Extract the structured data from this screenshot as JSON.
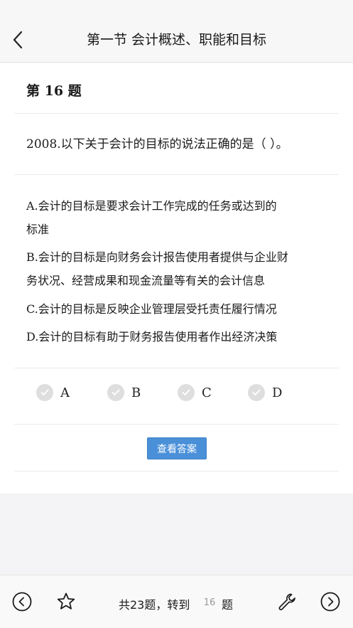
{
  "header": {
    "title": "第一节 会计概述、职能和目标"
  },
  "question": {
    "number_label": "第 16 题",
    "text": "2008.以下关于会计的目标的说法正确的是（  ）。",
    "options": [
      {
        "line1": "A.会计的目标是要求会计工作完成的任务或达到的",
        "line2": "标准"
      },
      {
        "line1": "B.会计的目标是向财务会计报告使用者提供与企业财",
        "line2": "务状况、经营成果和现金流量等有关的会计信息"
      },
      {
        "line1": "C.会计的目标是反映企业管理层受托责任履行情况"
      },
      {
        "line1": "D.会计的目标有助于财务报告使用者作出经济决策"
      }
    ],
    "choices": [
      "A",
      "B",
      "C",
      "D"
    ],
    "answer_button": "查看答案"
  },
  "footer": {
    "total_prefix": "共23题，转到",
    "page_value": "16",
    "suffix": "题"
  },
  "colors": {
    "accent": "#4a90d9",
    "check_bg": "#dedede"
  }
}
